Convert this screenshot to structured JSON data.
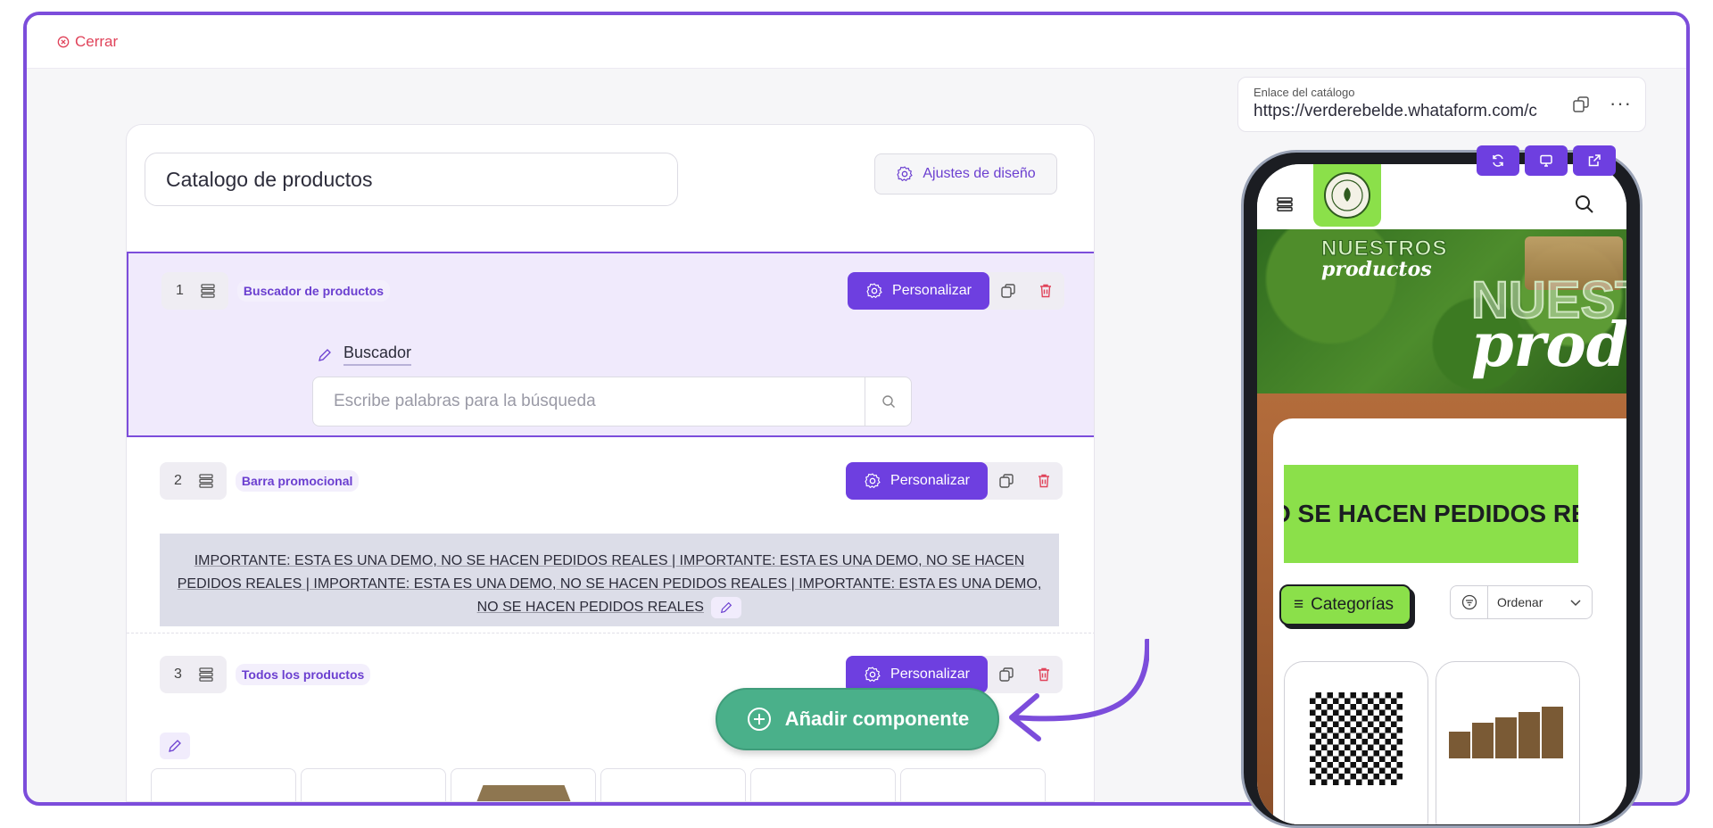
{
  "topbar": {
    "close_label": "Cerrar"
  },
  "editor": {
    "catalog_title": "Catalogo de productos",
    "design_settings_label": "Ajustes de diseño",
    "customize_label": "Personalizar",
    "blocks": [
      {
        "number": "1",
        "tag": "Buscador de productos"
      },
      {
        "number": "2",
        "tag": "Barra promocional"
      },
      {
        "number": "3",
        "tag": "Todos los productos"
      }
    ],
    "search_block": {
      "label": "Buscador",
      "placeholder": "Escribe palabras para la búsqueda"
    },
    "promo_text": "IMPORTANTE: ESTA ES UNA DEMO, NO SE HACEN PEDIDOS REALES | IMPORTANTE: ESTA ES UNA DEMO, NO SE HACEN PEDIDOS REALES | IMPORTANTE: ESTA ES UNA DEMO, NO SE HACEN PEDIDOS REALES | IMPORTANTE: ESTA ES UNA DEMO, NO SE HACEN PEDIDOS REALES",
    "add_component_label": "Añadir componente"
  },
  "catalog_link": {
    "label": "Enlace del catálogo",
    "url": "https://verderebelde.whataform.com/c",
    "more_label": "···"
  },
  "preview": {
    "hero_line1": "NUESTROS",
    "hero_line2": "productos",
    "hero_big1": "NUESTROS",
    "hero_big2": "productos",
    "promo_ticker": "O SE HACEN PEDIDOS REALES",
    "categories_label": "Categorías",
    "sort_label": "Ordenar"
  },
  "colors": {
    "accent": "#6e3fe0",
    "frame": "#7c4ddb",
    "add_button": "#4ab08a",
    "close_red": "#e0435a",
    "brand_green": "#8be04a"
  }
}
